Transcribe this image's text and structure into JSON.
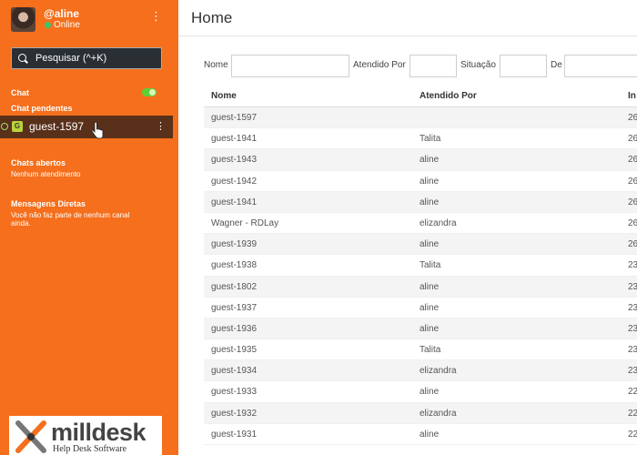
{
  "sidebar": {
    "username": "@aline",
    "status": "Online",
    "search_placeholder": "Pesquisar (^+K)",
    "chat_label": "Chat",
    "pending_label": "Chat pendentes",
    "pending_chat": "guest-1597",
    "open_chats_label": "Chats abertos",
    "open_chats_empty": "Nenhum atendimento",
    "direct_messages_label": "Mensagens Diretas",
    "direct_messages_empty": "Você não faz parte de nenhum canal ainda.",
    "kebab_icon": "⋮",
    "logo_name": "milldesk",
    "logo_tagline": "Help Desk Software"
  },
  "main": {
    "title": "Home",
    "filters": {
      "nome": "Nome",
      "atendido_por": "Atendido Por",
      "situacao": "Situação",
      "de": "De"
    },
    "columns": [
      "Nome",
      "Atendido Por",
      "In"
    ],
    "rows": [
      {
        "nome": "guest-1597",
        "atendido": "",
        "inicio": "26"
      },
      {
        "nome": "guest-1941",
        "atendido": "Talita",
        "inicio": "26"
      },
      {
        "nome": "guest-1943",
        "atendido": "aline",
        "inicio": "26"
      },
      {
        "nome": "guest-1942",
        "atendido": "aline",
        "inicio": "26"
      },
      {
        "nome": "guest-1941",
        "atendido": "aline",
        "inicio": "26"
      },
      {
        "nome": "Wagner - RDLay",
        "atendido": "elizandra",
        "inicio": "26"
      },
      {
        "nome": "guest-1939",
        "atendido": "aline",
        "inicio": "26"
      },
      {
        "nome": "guest-1938",
        "atendido": "Talita",
        "inicio": "23"
      },
      {
        "nome": "guest-1802",
        "atendido": "aline",
        "inicio": "23"
      },
      {
        "nome": "guest-1937",
        "atendido": "aline",
        "inicio": "23"
      },
      {
        "nome": "guest-1936",
        "atendido": "aline",
        "inicio": "23"
      },
      {
        "nome": "guest-1935",
        "atendido": "Talita",
        "inicio": "23"
      },
      {
        "nome": "guest-1934",
        "atendido": "elizandra",
        "inicio": "23"
      },
      {
        "nome": "guest-1933",
        "atendido": "aline",
        "inicio": "22"
      },
      {
        "nome": "guest-1932",
        "atendido": "elizandra",
        "inicio": "22"
      },
      {
        "nome": "guest-1931",
        "atendido": "aline",
        "inicio": "22"
      }
    ]
  },
  "colors": {
    "sidebar_bg": "#f56f1c",
    "selected_row_bg": "#59301a",
    "online": "#3ec46d"
  }
}
